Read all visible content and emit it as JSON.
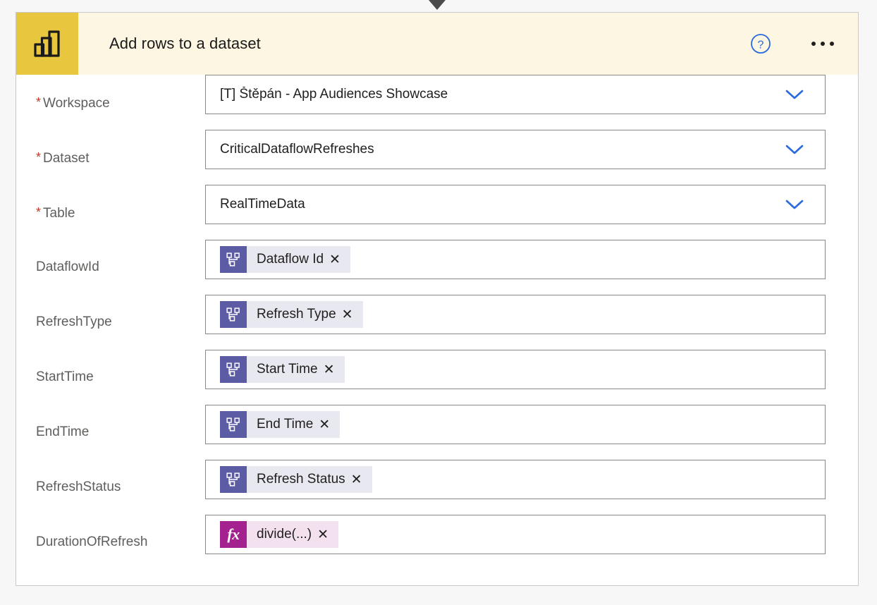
{
  "colors": {
    "page_background": "#f7f7f7",
    "card_background": "#ffffff",
    "card_border": "#c9c9c9",
    "header_background": "#fdf6e3",
    "app_icon_background": "#e8c73e",
    "accent_blue": "#2a6ae1",
    "required_asterisk": "#c0392b",
    "token_background": "#e8e8f0",
    "token_icon_background": "#5c5ca5",
    "expression_token_background": "#f3e1f0",
    "expression_token_icon_background": "#a4228f",
    "label_text": "#605e5c",
    "value_text": "#201f1e",
    "input_border": "#8a8886",
    "connector_arrow": "#4b4b4b"
  },
  "connector": {
    "icon": "arrow-down-icon"
  },
  "header": {
    "app_icon": "power-bi-icon",
    "title": "Add rows to a dataset",
    "help_icon": "help-circle-icon",
    "help_label": "?",
    "more_icon": "more-horizontal-icon"
  },
  "fields": [
    {
      "label": "Workspace",
      "required": true,
      "type": "dropdown",
      "value": "[T] Štěpán - App Audiences Showcase",
      "chevron_icon": "chevron-down-icon",
      "name": "workspace"
    },
    {
      "label": "Dataset",
      "required": true,
      "type": "dropdown",
      "value": "CriticalDataflowRefreshes",
      "chevron_icon": "chevron-down-icon",
      "name": "dataset"
    },
    {
      "label": "Table",
      "required": true,
      "type": "dropdown",
      "value": "RealTimeData",
      "chevron_icon": "chevron-down-icon",
      "name": "table"
    },
    {
      "label": "DataflowId",
      "required": false,
      "type": "token",
      "token_kind": "dynamic-content",
      "token_icon": "dynamic-content-node-icon",
      "token_label": "Dataflow Id",
      "remove_label": "✕",
      "name": "dataflowid"
    },
    {
      "label": "RefreshType",
      "required": false,
      "type": "token",
      "token_kind": "dynamic-content",
      "token_icon": "dynamic-content-node-icon",
      "token_label": "Refresh Type",
      "remove_label": "✕",
      "name": "refreshtype"
    },
    {
      "label": "StartTime",
      "required": false,
      "type": "token",
      "token_kind": "dynamic-content",
      "token_icon": "dynamic-content-node-icon",
      "token_label": "Start Time",
      "remove_label": "✕",
      "name": "starttime"
    },
    {
      "label": "EndTime",
      "required": false,
      "type": "token",
      "token_kind": "dynamic-content",
      "token_icon": "dynamic-content-node-icon",
      "token_label": "End Time",
      "remove_label": "✕",
      "name": "endtime"
    },
    {
      "label": "RefreshStatus",
      "required": false,
      "type": "token",
      "token_kind": "dynamic-content",
      "token_icon": "dynamic-content-node-icon",
      "token_label": "Refresh Status",
      "remove_label": "✕",
      "name": "refreshstatus"
    },
    {
      "label": "DurationOfRefresh",
      "required": false,
      "type": "token",
      "token_kind": "expression",
      "token_icon": "function-fx-icon",
      "token_icon_text": "fx",
      "token_label": "divide(...)",
      "remove_label": "✕",
      "name": "durationofrefresh"
    }
  ]
}
